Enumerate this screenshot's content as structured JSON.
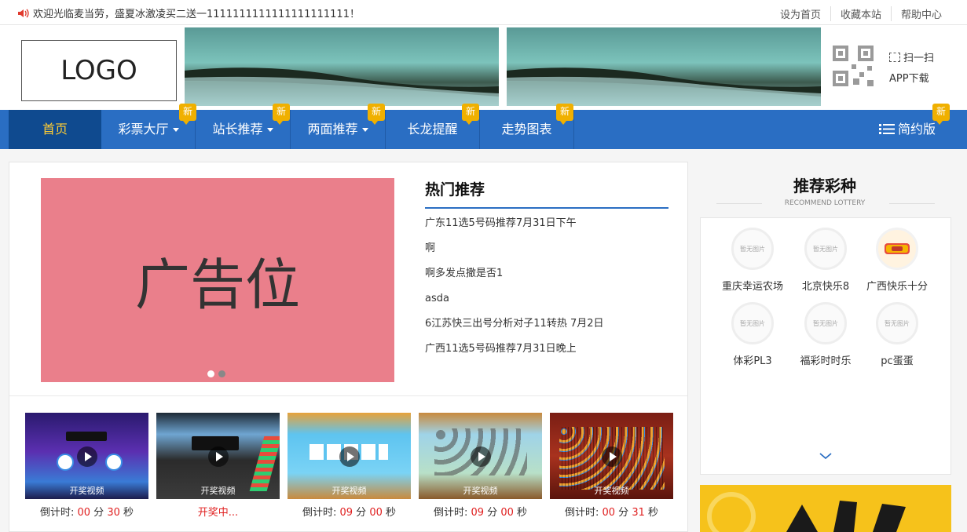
{
  "topbar": {
    "notice": "欢迎光临麦当劳，盛夏冰激凌买二送一1111111111111111111111！",
    "links": [
      "设为首页",
      "收藏本站",
      "帮助中心"
    ]
  },
  "header": {
    "logo": "LOGO",
    "qr_line1": "扫一扫",
    "qr_line2": "APP下载"
  },
  "nav": {
    "home": "首页",
    "items": [
      "彩票大厅",
      "站长推荐",
      "两面推荐",
      "长龙提醒",
      "走势图表"
    ],
    "simple": "简约版",
    "badge": "新"
  },
  "ad": {
    "text": "广告位"
  },
  "hot": {
    "title": "热门推荐",
    "items": [
      "广东11选5号码推荐7月31日下午",
      "啊",
      "啊多发点撒是否1",
      "asda",
      "6江苏快三出号分析对子11转热 7月2日",
      "广西11选5号码推荐7月31日晚上"
    ]
  },
  "videos": [
    {
      "label": "开奖视频",
      "prefix": "倒计时:",
      "h": "00",
      "m": "30",
      "unit_m": "分",
      "unit_s": "秒"
    },
    {
      "label": "开奖视频",
      "status": "开奖中..."
    },
    {
      "label": "开奖视频",
      "prefix": "倒计时:",
      "h": "09",
      "m": "00",
      "unit_m": "分",
      "unit_s": "秒"
    },
    {
      "label": "开奖视频",
      "prefix": "倒计时:",
      "h": "09",
      "m": "00",
      "unit_m": "分",
      "unit_s": "秒"
    },
    {
      "label": "开奖视频",
      "prefix": "倒计时:",
      "h": "00",
      "m": "31",
      "unit_m": "分",
      "unit_s": "秒"
    }
  ],
  "recommend": {
    "title": "推荐彩种",
    "subtitle": "RECOMMEND LOTTERY",
    "placeholder": "暂无图片",
    "lotteries": [
      "重庆幸运农场",
      "北京快乐8",
      "广西快乐十分",
      "体彩PL3",
      "福彩时时乐",
      "pc蛋蛋"
    ]
  },
  "colors": {
    "nav": "#2a6ec3",
    "home_bg": "#0f4a8f",
    "badge": "#f0b000",
    "ad_bg": "#ea7f8b",
    "accent_red": "#e02020"
  }
}
